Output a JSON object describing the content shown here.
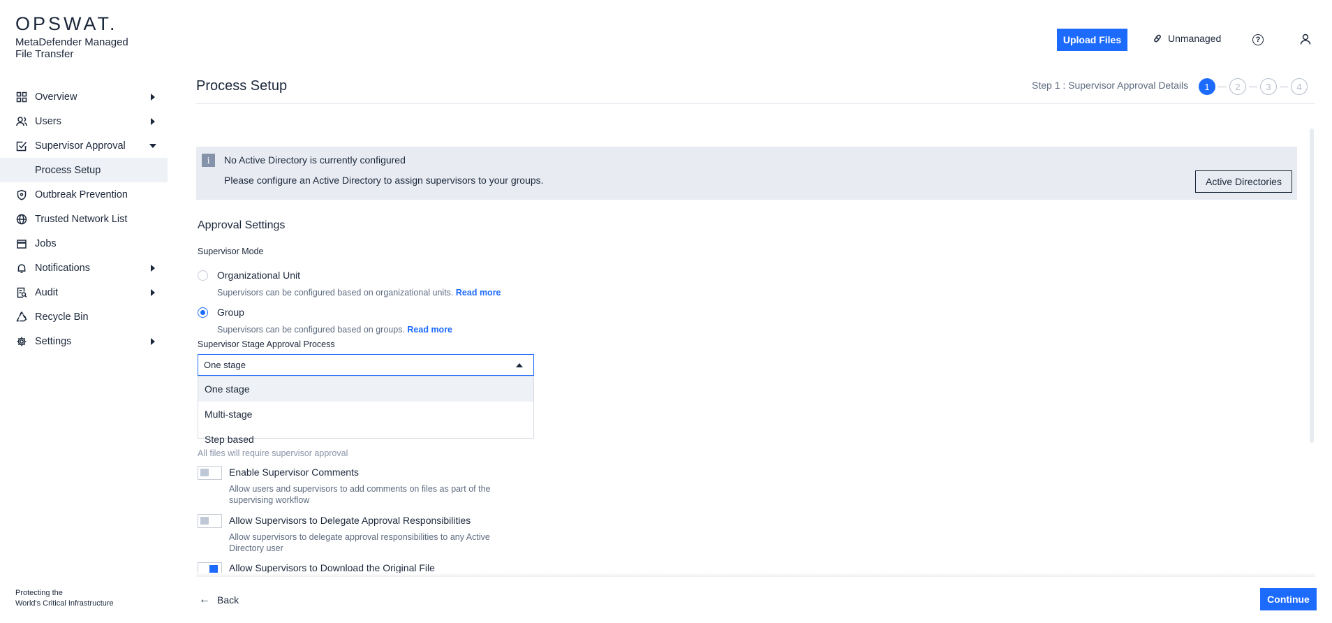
{
  "brand": {
    "logo": "OPSWAT.",
    "product": "MetaDefender Managed File Transfer",
    "tagline_line1": "Protecting the",
    "tagline_line2": "World's Critical Infrastructure"
  },
  "header": {
    "upload_label": "Upload Files",
    "unmanaged_label": "Unmanaged",
    "help_icon": "question-circle-icon",
    "user_icon": "user-icon"
  },
  "sidebar": {
    "items": [
      {
        "label": "Overview",
        "icon": "grid-icon",
        "caret": "right"
      },
      {
        "label": "Users",
        "icon": "users-icon",
        "caret": "right"
      },
      {
        "label": "Supervisor Approval",
        "icon": "checkbox-icon",
        "caret": "down"
      },
      {
        "label": "Outbreak Prevention",
        "icon": "shield-icon"
      },
      {
        "label": "Trusted Network List",
        "icon": "globe-icon"
      },
      {
        "label": "Jobs",
        "icon": "calendar-icon"
      },
      {
        "label": "Notifications",
        "icon": "bell-icon",
        "caret": "right"
      },
      {
        "label": "Audit",
        "icon": "audit-icon",
        "caret": "right"
      },
      {
        "label": "Recycle Bin",
        "icon": "recycle-icon"
      },
      {
        "label": "Settings",
        "icon": "gear-icon",
        "caret": "right"
      }
    ],
    "sub_item": "Process Setup"
  },
  "page": {
    "title": "Process Setup",
    "step_label": "Step 1 : Supervisor Approval Details",
    "steps": [
      "1",
      "2",
      "3",
      "4"
    ],
    "active_step": 1
  },
  "alert": {
    "icon": "info-icon",
    "title": "No Active Directory is currently configured",
    "text": "Please configure an Active Directory to assign supervisors to your groups.",
    "button": "Active Directories"
  },
  "approval": {
    "section_title": "Approval Settings",
    "mode_label": "Supervisor Mode",
    "modes": [
      {
        "label": "Organizational Unit",
        "help": "Supervisors can be configured based on organizational units.",
        "link": "Read more",
        "selected": false
      },
      {
        "label": "Group",
        "help": "Supervisors can be configured based on groups.",
        "link": "Read more",
        "selected": true
      }
    ],
    "stage_label": "Supervisor Stage Approval Process",
    "stage_value": "One stage",
    "stage_options": [
      "One stage",
      "Multi-stage",
      "Step based"
    ],
    "faded_help": "All files will require supervisor approval"
  },
  "toggles": [
    {
      "label": "Enable Supervisor Comments",
      "help_line1": "Allow users and supervisors to add comments on files as part of the",
      "help_line2": "supervising workflow",
      "on": false
    },
    {
      "label": "Allow Supervisors to Delegate Approval Responsibilities",
      "help_line1": "Allow supervisors to delegate approval responsibilities to any Active",
      "help_line2": "Directory user",
      "on": false
    },
    {
      "label": "Allow Supervisors to Download the Original File",
      "on": true
    }
  ],
  "footer": {
    "back_label": "Back",
    "continue_label": "Continue"
  },
  "colors": {
    "accent": "#1d6bfc",
    "text": "#1b273a",
    "muted": "#5d6b80",
    "alert_bg": "#e8ecf2"
  }
}
